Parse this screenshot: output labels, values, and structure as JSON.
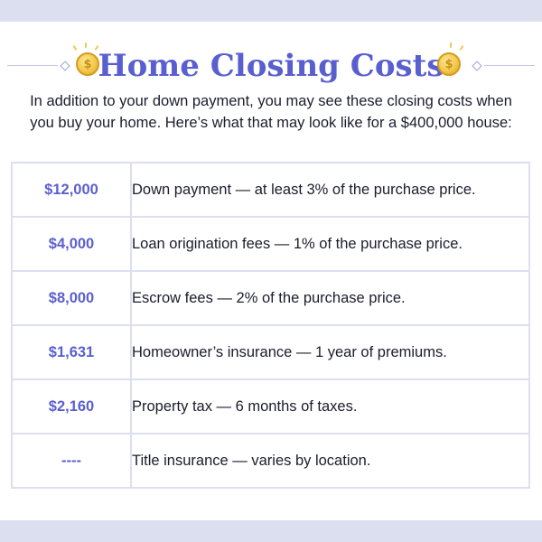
{
  "header": {
    "title": "Home Closing Costs",
    "icon": "coin-icon",
    "coin_symbol": "$",
    "accent_color": "#5a5fcf"
  },
  "intro": "In addition to your down payment, you may see these closing costs when you buy your home. Here’s what that may look like for a $400,000 house:",
  "costs": [
    {
      "amount": "$12,000",
      "description": "Down payment — at least 3% of the purchase price."
    },
    {
      "amount": "$4,000",
      "description": "Loan origination fees — 1% of the purchase price."
    },
    {
      "amount": "$8,000",
      "description": "Escrow fees — 2% of the purchase price."
    },
    {
      "amount": "$1,631",
      "description": "Homeowner’s insurance — 1 year of premiums."
    },
    {
      "amount": "$2,160",
      "description": "Property tax — 6 months of taxes."
    },
    {
      "amount": "----",
      "description": "Title insurance — varies by location."
    }
  ]
}
